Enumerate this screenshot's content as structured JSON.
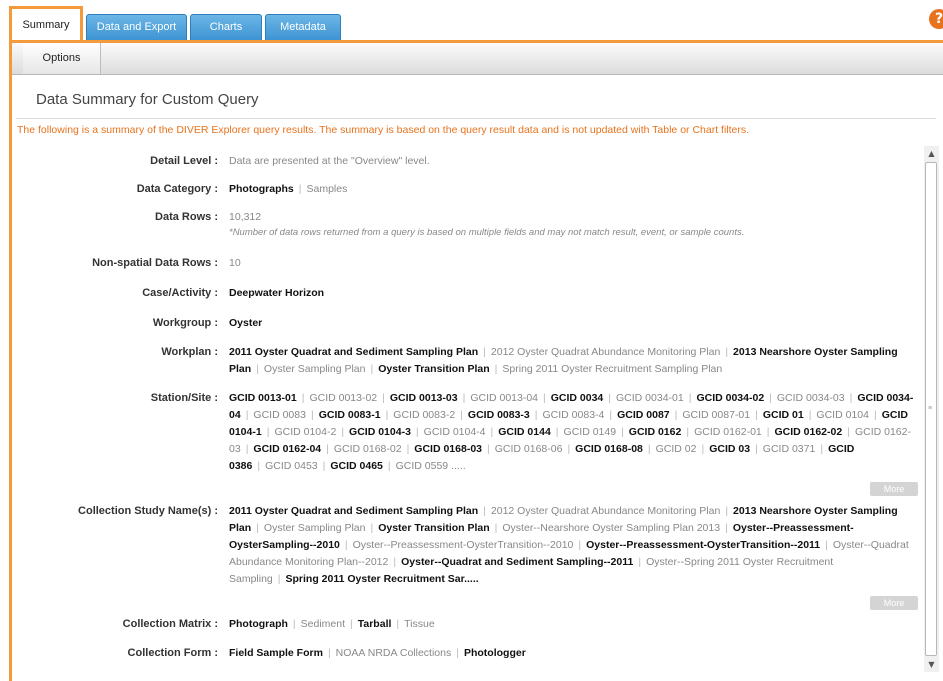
{
  "tabs": [
    {
      "label": "Summary",
      "active": true
    },
    {
      "label": "Data and Export",
      "active": false
    },
    {
      "label": "Charts",
      "active": false
    },
    {
      "label": "Metadata",
      "active": false
    }
  ],
  "help_icon": "?",
  "toolbar": {
    "options_label": "Options"
  },
  "page_title": "Data Summary for Custom Query",
  "notice": "The following is a summary of the DIVER Explorer query results. The summary is based on the query result data and is not updated with Table or Chart filters.",
  "more_label": "More",
  "colors": {
    "accent": "#f39a3c",
    "tab_blue": "#4a9fdc",
    "notice": "#e8731e"
  },
  "rows": [
    {
      "label": "Detail Level :",
      "items": [
        {
          "t": "Data are presented at the \"Overview\" level.",
          "s": 0
        }
      ]
    },
    {
      "label": "Data Category :",
      "items": [
        {
          "t": "Photographs",
          "s": 1
        },
        {
          "t": "Samples",
          "s": 0
        }
      ]
    },
    {
      "label": "Data Rows :",
      "items": [
        {
          "t": "10,312",
          "s": 0
        }
      ],
      "note": "*Number of data rows returned from a query is based on multiple fields and may not match result, event, or sample counts."
    },
    {
      "label": "Non-spatial Data Rows :",
      "items": [
        {
          "t": "10",
          "s": 0
        }
      ]
    },
    {
      "label": "Case/Activity :",
      "items": [
        {
          "t": "Deepwater Horizon",
          "s": 1
        }
      ]
    },
    {
      "label": "Workgroup :",
      "items": [
        {
          "t": "Oyster",
          "s": 1
        }
      ]
    },
    {
      "label": "Workplan :",
      "items": [
        {
          "t": "2011 Oyster Quadrat and Sediment Sampling Plan",
          "s": 1
        },
        {
          "t": "2012 Oyster Quadrat Abundance Monitoring Plan",
          "s": 0
        },
        {
          "t": "2013 Nearshore Oyster Sampling Plan",
          "s": 1
        },
        {
          "t": "Oyster Sampling Plan",
          "s": 0
        },
        {
          "t": "Oyster Transition Plan",
          "s": 1
        },
        {
          "t": "Spring 2011 Oyster Recruitment Sampling Plan",
          "s": 0
        }
      ]
    },
    {
      "label": "Station/Site :",
      "more": true,
      "items": [
        {
          "t": "GCID 0013-01",
          "s": 1
        },
        {
          "t": "GCID 0013-02",
          "s": 0
        },
        {
          "t": "GCID 0013-03",
          "s": 1
        },
        {
          "t": "GCID 0013-04",
          "s": 0
        },
        {
          "t": "GCID 0034",
          "s": 1
        },
        {
          "t": "GCID 0034-01",
          "s": 0
        },
        {
          "t": "GCID 0034-02",
          "s": 1
        },
        {
          "t": "GCID 0034-03",
          "s": 0
        },
        {
          "t": "GCID 0034-04",
          "s": 1
        },
        {
          "t": "GCID 0083",
          "s": 0
        },
        {
          "t": "GCID 0083-1",
          "s": 1
        },
        {
          "t": "GCID 0083-2",
          "s": 0
        },
        {
          "t": "GCID 0083-3",
          "s": 1
        },
        {
          "t": "GCID 0083-4",
          "s": 0
        },
        {
          "t": "GCID 0087",
          "s": 1
        },
        {
          "t": "GCID 0087-01",
          "s": 0
        },
        {
          "t": "GCID 01",
          "s": 1
        },
        {
          "t": "GCID 0104",
          "s": 0
        },
        {
          "t": "GCID 0104-1",
          "s": 1
        },
        {
          "t": "GCID 0104-2",
          "s": 0
        },
        {
          "t": "GCID 0104-3",
          "s": 1
        },
        {
          "t": "GCID 0104-4",
          "s": 0
        },
        {
          "t": "GCID 0144",
          "s": 1
        },
        {
          "t": "GCID 0149",
          "s": 0
        },
        {
          "t": "GCID 0162",
          "s": 1
        },
        {
          "t": "GCID 0162-01",
          "s": 0
        },
        {
          "t": "GCID 0162-02",
          "s": 1
        },
        {
          "t": "GCID 0162-03",
          "s": 0
        },
        {
          "t": "GCID 0162-04",
          "s": 1
        },
        {
          "t": "GCID 0168-02",
          "s": 0
        },
        {
          "t": "GCID 0168-03",
          "s": 1
        },
        {
          "t": "GCID 0168-06",
          "s": 0
        },
        {
          "t": "GCID 0168-08",
          "s": 1
        },
        {
          "t": "GCID 02",
          "s": 0
        },
        {
          "t": "GCID 03",
          "s": 1
        },
        {
          "t": "GCID 0371",
          "s": 0
        },
        {
          "t": "GCID 0386",
          "s": 1
        },
        {
          "t": "GCID 0453",
          "s": 0
        },
        {
          "t": "GCID 0465",
          "s": 1
        },
        {
          "t": "GCID 0559 .....",
          "s": 0
        }
      ]
    },
    {
      "label": "Collection Study Name(s) :",
      "more": true,
      "items": [
        {
          "t": "2011 Oyster Quadrat and Sediment Sampling Plan",
          "s": 1
        },
        {
          "t": "2012 Oyster Quadrat Abundance Monitoring Plan",
          "s": 0
        },
        {
          "t": "2013 Nearshore Oyster Sampling Plan",
          "s": 1
        },
        {
          "t": "Oyster Sampling Plan",
          "s": 0
        },
        {
          "t": "Oyster Transition Plan",
          "s": 1
        },
        {
          "t": "Oyster--Nearshore Oyster Sampling Plan 2013",
          "s": 0
        },
        {
          "t": "Oyster--Preassessment-OysterSampling--2010",
          "s": 1
        },
        {
          "t": "Oyster--Preassessment-OysterTransition--2010",
          "s": 0
        },
        {
          "t": "Oyster--Preassessment-OysterTransition--2011",
          "s": 1
        },
        {
          "t": "Oyster--Quadrat Abundance Monitoring Plan--2012",
          "s": 0
        },
        {
          "t": "Oyster--Quadrat and Sediment Sampling--2011",
          "s": 1
        },
        {
          "t": "Oyster--Spring 2011 Oyster Recruitment Sampling",
          "s": 0
        },
        {
          "t": "Spring 2011 Oyster Recruitment Sar.....",
          "s": 1
        }
      ]
    },
    {
      "label": "Collection Matrix :",
      "items": [
        {
          "t": "Photograph",
          "s": 1
        },
        {
          "t": "Sediment",
          "s": 0
        },
        {
          "t": "Tarball",
          "s": 1
        },
        {
          "t": "Tissue",
          "s": 0
        }
      ]
    },
    {
      "label": "Collection Form :",
      "items": [
        {
          "t": "Field Sample Form",
          "s": 1
        },
        {
          "t": "NOAA NRDA Collections",
          "s": 0
        },
        {
          "t": "Photologger",
          "s": 1
        }
      ]
    }
  ]
}
